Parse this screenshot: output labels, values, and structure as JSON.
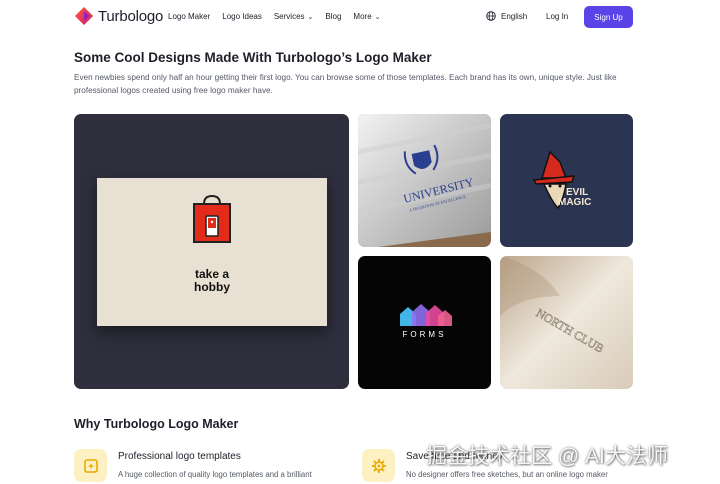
{
  "brand": {
    "name": "Turbologo"
  },
  "nav": {
    "items": [
      {
        "label": "Logo Maker",
        "dropdown": false
      },
      {
        "label": "Logo Ideas",
        "dropdown": false
      },
      {
        "label": "Services",
        "dropdown": true
      },
      {
        "label": "Blog",
        "dropdown": false
      },
      {
        "label": "More",
        "dropdown": true
      }
    ],
    "language": "English",
    "login": "Log In",
    "signup": "Sign Up"
  },
  "showcase": {
    "title": "Some Cool Designs Made With Turbologo’s Logo Maker",
    "description": "Even newbies spend only half an hour getting their first logo. You can browse some of those templates. Each brand has its own, unique style. Just like professional logos created using free logo maker have.",
    "gallery": {
      "hobby": {
        "line1": "take a",
        "line2": "hobby"
      },
      "university": {
        "name": "UNIVERSITY",
        "tagline": "A TRADITION OF EXCELLENCE"
      },
      "evil_magic": {
        "line1": "EVIL",
        "line2": "MAGIC"
      },
      "forms": {
        "name": "FORMS"
      },
      "north_club": {
        "name": "NORTH CLUB"
      }
    }
  },
  "why": {
    "title": "Why Turbologo Logo Maker",
    "features": [
      {
        "icon": "star-sparkle-icon",
        "title": "Professional logo templates",
        "text": "A huge collection of quality logo templates and a brilliant"
      },
      {
        "icon": "gear-icon",
        "title": "Save time and money",
        "text": "No designer offers free sketches, but an online logo maker"
      }
    ]
  },
  "watermark": "掘金技术社区 @ AI大法师",
  "colors": {
    "accent": "#5a44e8",
    "feature_icon_bg": "#fdf1c4",
    "feature_icon_fg": "#e8a800"
  }
}
